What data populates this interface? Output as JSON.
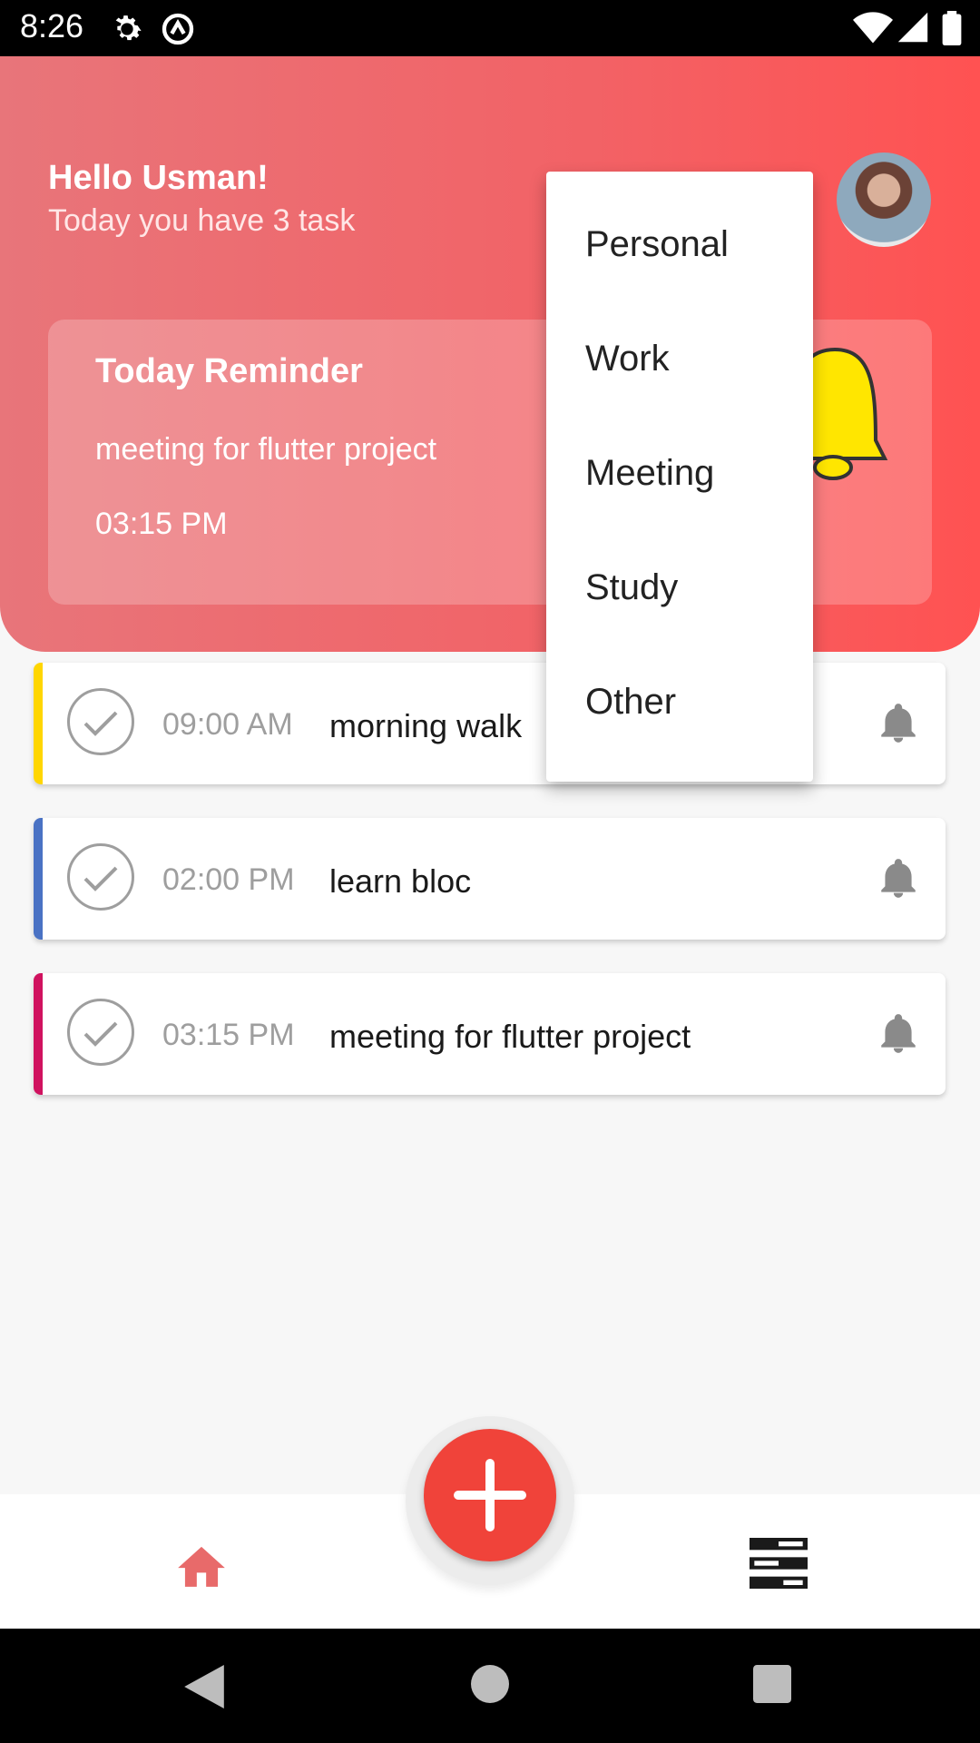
{
  "status_bar": {
    "time": "8:26"
  },
  "header": {
    "greeting": "Hello Usman!",
    "subtitle": "Today you have 3 task",
    "reminder": {
      "title": "Today Reminder",
      "text": "meeting for flutter project",
      "time": "03:15 PM"
    }
  },
  "tasks": [
    {
      "time": "09:00 AM",
      "name": "morning walk",
      "color": "#ffd600"
    },
    {
      "time": "02:00 PM",
      "name": "learn bloc",
      "color": "#4a72c4"
    },
    {
      "time": "03:15 PM",
      "name": "meeting for flutter project",
      "color": "#d0125f"
    }
  ],
  "menu": {
    "items": [
      "Personal",
      "Work",
      "Meeting",
      "Study",
      "Other"
    ]
  },
  "colors": {
    "accent": "#f0433a",
    "header_start": "#e8757a",
    "header_end": "#ff5252"
  }
}
